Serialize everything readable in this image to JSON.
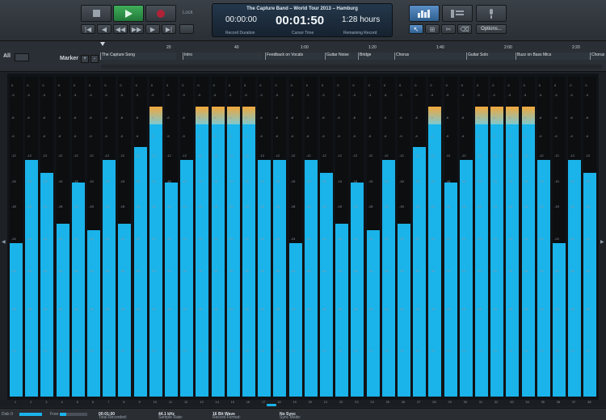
{
  "transport": {
    "stop_icon": "stop-icon",
    "play_icon": "play-icon",
    "record_icon": "record-icon",
    "lock_label": "Lock",
    "nav_icons": [
      "skip-start-icon",
      "prev-icon",
      "rewind-icon",
      "forward-icon",
      "next-icon",
      "skip-end-icon"
    ]
  },
  "display": {
    "title": "The Capture Band – World Tour 2013 – Hamburg",
    "record_duration": "00:00:00",
    "record_duration_label": "Record Duration",
    "cursor_time": "00:01:50",
    "cursor_time_label": "Cursor Time",
    "remaining": "1:28 hours",
    "remaining_label": "Remaining Record"
  },
  "views": {
    "options_label": "Options...",
    "icons": [
      "meter-view-icon",
      "track-view-icon",
      "mic-icon",
      "pointer-tool-icon",
      "range-tool-icon",
      "split-tool-icon",
      "eraser-tool-icon"
    ]
  },
  "timeline": {
    "all_label": "All",
    "marker_label": "Marker",
    "ticks": [
      "20",
      "40",
      "1:00",
      "1:20",
      "1:40",
      "2:00",
      "2:20"
    ],
    "markers": [
      "The Capture Song",
      "Intro",
      "Feedback on Vocals",
      "Guitar Noise",
      "Bridge",
      "Chorus",
      "Guitar Solo",
      "Buzz on Bass Mics",
      "Chorus"
    ]
  },
  "meters": {
    "scale_labels": [
      "0",
      "-3",
      "-6",
      "-9",
      "-12",
      "-15",
      "-18",
      "-24",
      "-30",
      "-48",
      "-72"
    ],
    "levels": [
      0.48,
      0.74,
      0.7,
      0.54,
      0.67,
      0.52,
      0.74,
      0.54,
      0.78,
      0.85,
      0.67,
      0.74,
      0.85,
      0.85,
      0.85,
      0.85,
      0.74,
      0.74,
      0.48,
      0.74,
      0.7,
      0.54,
      0.67,
      0.52,
      0.74,
      0.54,
      0.78,
      0.85,
      0.67,
      0.74,
      0.85,
      0.85,
      0.85,
      0.85,
      0.74,
      0.48,
      0.74,
      0.7
    ],
    "peak": [
      false,
      false,
      false,
      false,
      false,
      false,
      false,
      false,
      false,
      true,
      false,
      false,
      true,
      true,
      true,
      true,
      false,
      false,
      false,
      false,
      false,
      false,
      false,
      false,
      false,
      false,
      false,
      true,
      false,
      false,
      true,
      true,
      true,
      true,
      false,
      false,
      false,
      false
    ],
    "channel_numbers": [
      "1",
      "2",
      "3",
      "4",
      "5",
      "6",
      "7",
      "8",
      "9",
      "10",
      "11",
      "12",
      "13",
      "14",
      "15",
      "16",
      "17",
      "18",
      "19",
      "20",
      "21",
      "22",
      "23",
      "24",
      "25",
      "26",
      "27",
      "28",
      "29",
      "30",
      "31",
      "32",
      "33",
      "34",
      "35",
      "36",
      "37",
      "38"
    ]
  },
  "status": {
    "disk_label": "Disk 0",
    "free_label": "Free",
    "total_recorded_label": "Total Recorded:",
    "total_recorded": "00:01:00",
    "sample_rate_label": "Sample Rate:",
    "sample_rate": "44.1 kHz",
    "record_format_label": "Record Format:",
    "record_format": "16 Bit Wave",
    "sync_mode_label": "Sync Mode:",
    "sync_mode": "No Sync"
  }
}
